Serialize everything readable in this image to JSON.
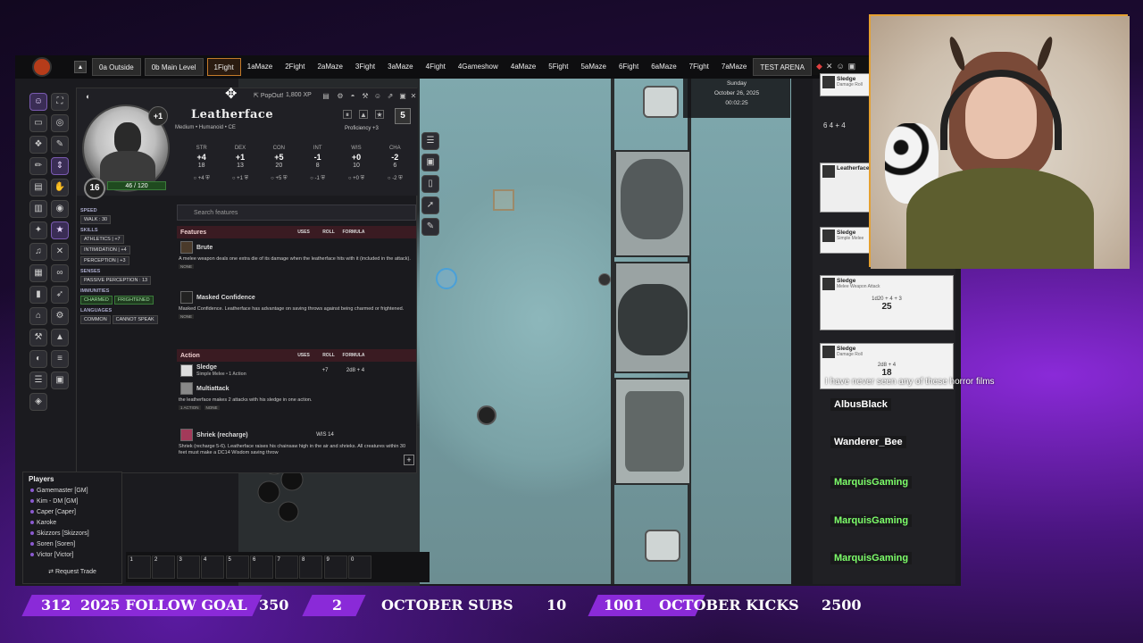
{
  "scenes": [
    "0a Outside",
    "0b Main Level",
    "1Fight",
    "1aMaze",
    "2Fight",
    "2aMaze",
    "3Fight",
    "3aMaze",
    "4Fight",
    "4Gameshow",
    "4aMaze",
    "5Fight",
    "5aMaze",
    "6Fight",
    "6aMaze",
    "7Fight",
    "7aMaze",
    "TEST ARENA"
  ],
  "active_scene": "1Fight",
  "sheet": {
    "popout": "PopOut!",
    "xp": "1,800 XP",
    "level_badge": "+1",
    "name": "Leatherface",
    "type": "Medium • Humanoid • CE",
    "proficiency": "Proficiency +3",
    "inspiration": "5",
    "ac": "16",
    "hp": "46",
    "hp_max": "120",
    "hp_fraction": 0.38,
    "abilities": [
      {
        "name": "STR",
        "mod": "+4",
        "score": "18",
        "save": "+4"
      },
      {
        "name": "DEX",
        "mod": "+1",
        "score": "13",
        "save": "+1"
      },
      {
        "name": "CON",
        "mod": "+5",
        "score": "20",
        "save": "+5"
      },
      {
        "name": "INT",
        "mod": "-1",
        "score": "8",
        "save": "-1"
      },
      {
        "name": "WIS",
        "mod": "+0",
        "score": "10",
        "save": "+0"
      },
      {
        "name": "CHA",
        "mod": "-2",
        "score": "6",
        "save": "-2"
      }
    ],
    "speed_head": "SPEED",
    "speed": "WALK : 30",
    "skills_head": "SKILLS",
    "skills": [
      "ATHLETICS | +7",
      "INTIMIDATION | +4",
      "PERCEPTION | +3"
    ],
    "senses_head": "SENSES",
    "senses": "PASSIVE PERCEPTION : 13",
    "immunities_head": "IMMUNITIES",
    "immunities": [
      "CHARMED",
      "FRIGHTENED"
    ],
    "languages_head": "LANGUAGES",
    "languages": [
      "COMMON",
      "CANNOT SPEAK"
    ],
    "search_placeholder": "Search features",
    "features_header": {
      "name": "Features",
      "uses": "USES",
      "roll": "ROLL",
      "formula": "FORMULA"
    },
    "features": [
      {
        "name": "Brute",
        "desc": "A melee weapon deals one extra die of its damage when the leatherface hits with it (included in the attack).",
        "tag": "NONE"
      },
      {
        "name": "Masked Confidence",
        "desc": "Masked Confidence. Leatherface has advantage on saving throws against being charmed or frightened.",
        "tag": "NONE"
      }
    ],
    "action_header": {
      "name": "Action",
      "uses": "USES",
      "roll": "ROLL",
      "formula": "FORMULA"
    },
    "actions": [
      {
        "name": "Sledge",
        "sub": "Simple Melee • 1 Action",
        "roll": "+7",
        "formula": "2d8 + 4"
      },
      {
        "name": "Multiattack",
        "sub": "",
        "roll": "",
        "formula": "",
        "desc": "the leatherface makes 2 attacks with his sledge in one action.",
        "tags": [
          "1 ACTION",
          "NONE"
        ]
      },
      {
        "name": "Shriek (recharge)",
        "sub": "",
        "roll": "WIS 14",
        "formula": "",
        "desc": "Shriek (recharge 5-6). Leatherface raises his chainsaw high in the air and shrieks. All creatures within 30 feet must make a DC14 Wisdom saving throw"
      }
    ]
  },
  "datetime": {
    "day": "Sunday",
    "date": "October 26, 2025",
    "time": "00:02:25"
  },
  "players": {
    "title": "Players",
    "list": [
      "Gamemaster [GM]",
      "Kim - DM [GM]",
      "Caper [Caper]",
      "Karoke",
      "Skizzors [Skizzors]",
      "Soren [Soren]",
      "Victor [Victor]"
    ],
    "trade": "Request Trade"
  },
  "hotbar": [
    "1",
    "2",
    "3",
    "4",
    "5",
    "6",
    "7",
    "8",
    "9",
    "0"
  ],
  "chat_cards": [
    {
      "title": "Sledge",
      "sub": "Damage Roll"
    },
    {
      "title": "Leatherface",
      "sub": ""
    },
    {
      "title": "Sledge",
      "sub": "Simple Melee"
    },
    {
      "title": "Sledge",
      "sub": "Melee Weapon Attack",
      "formula": "1d20 + 4 + 3",
      "result": "25"
    },
    {
      "title": "Sledge",
      "sub": "Damage Roll",
      "formula": "2d8 + 4",
      "result": "18"
    }
  ],
  "dice_row": "6  4  + 4",
  "chat_overlay": {
    "message": "I have never seen any of these horror films",
    "names": [
      "AlbusBlack",
      "Wanderer_Bee",
      "MarquisGaming",
      "MarquisGaming",
      "MarquisGaming"
    ]
  },
  "goals": {
    "follow": {
      "current": "312",
      "label": "2025 FOLLOW GOAL",
      "target": "350",
      "progress": 0.89
    },
    "subs": {
      "current": "2",
      "label": "OCTOBER SUBS",
      "target": "10",
      "progress": 0.2
    },
    "kicks": {
      "current": "1001",
      "label": "OCTOBER KICKS",
      "target": "2500",
      "progress": 0.4
    }
  },
  "colors": {
    "accent": "#8a2ad8",
    "hp": "#2f8a2f",
    "section": "#3a1b22"
  }
}
